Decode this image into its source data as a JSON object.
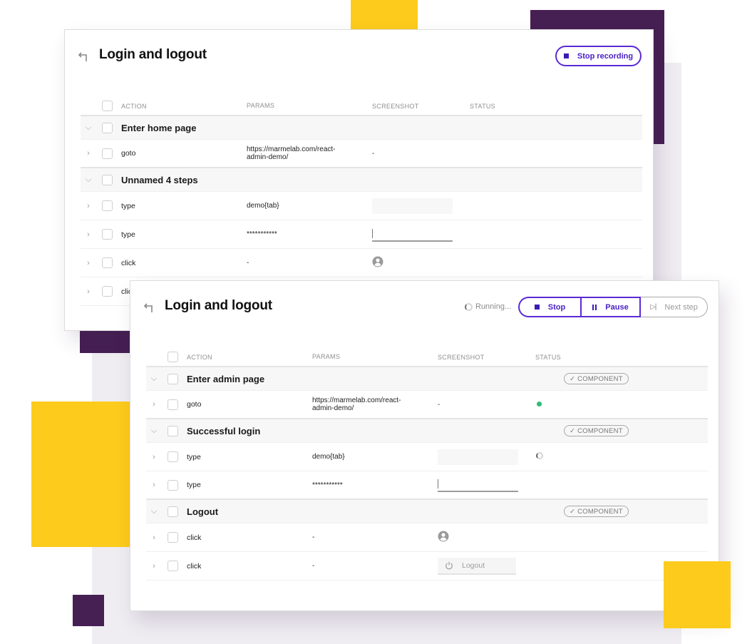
{
  "recording_panel": {
    "title": "Login and logout",
    "stop_recording_label": "Stop recording",
    "columns": [
      "ACTION",
      "PARAMS",
      "SCREENSHOT",
      "STATUS"
    ],
    "groups": [
      {
        "name": "Enter home page",
        "steps": [
          {
            "action": "goto",
            "params": "https://marmelab.com/react-admin-demo/",
            "screenshot": "-",
            "screenshot_kind": "text"
          }
        ]
      },
      {
        "name": "Unnamed 4 steps",
        "steps": [
          {
            "action": "type",
            "params": "demo{tab}",
            "screenshot_kind": "blank-field"
          },
          {
            "action": "type",
            "params": "***********",
            "screenshot_kind": "input-field"
          },
          {
            "action": "click",
            "params": "-",
            "screenshot_kind": "avatar-icon"
          },
          {
            "action": "click",
            "params": "",
            "screenshot_kind": "none"
          }
        ]
      }
    ]
  },
  "running_panel": {
    "title": "Login and logout",
    "status_text": "Running...",
    "controls": {
      "stop_label": "Stop",
      "pause_label": "Pause",
      "next_step_label": "Next step"
    },
    "columns": [
      "ACTION",
      "PARAMS",
      "SCREENSHOT",
      "STATUS"
    ],
    "groups": [
      {
        "name": "Enter admin page",
        "badge": "COMPONENT",
        "steps": [
          {
            "action": "goto",
            "params": "https://marmelab.com/react-admin-demo/",
            "screenshot": "-",
            "status": "success"
          }
        ]
      },
      {
        "name": "Successful login",
        "badge": "COMPONENT",
        "steps": [
          {
            "action": "type",
            "params": "demo{tab}",
            "screenshot_kind": "blank-field",
            "status": "running"
          },
          {
            "action": "type",
            "params": "***********",
            "screenshot_kind": "input-field",
            "status": ""
          }
        ]
      },
      {
        "name": "Logout",
        "badge": "COMPONENT",
        "steps": [
          {
            "action": "click",
            "params": "-",
            "screenshot_kind": "avatar-icon",
            "status": ""
          },
          {
            "action": "click",
            "params": "-",
            "screenshot_kind": "logout-button",
            "screenshot_label": "Logout",
            "status": ""
          }
        ]
      }
    ]
  },
  "colors": {
    "accent_purple": "#5b2bd3",
    "brand_dark_purple": "#461f53",
    "brand_yellow": "#fdcb1c",
    "success_green": "#2ebb7a"
  }
}
